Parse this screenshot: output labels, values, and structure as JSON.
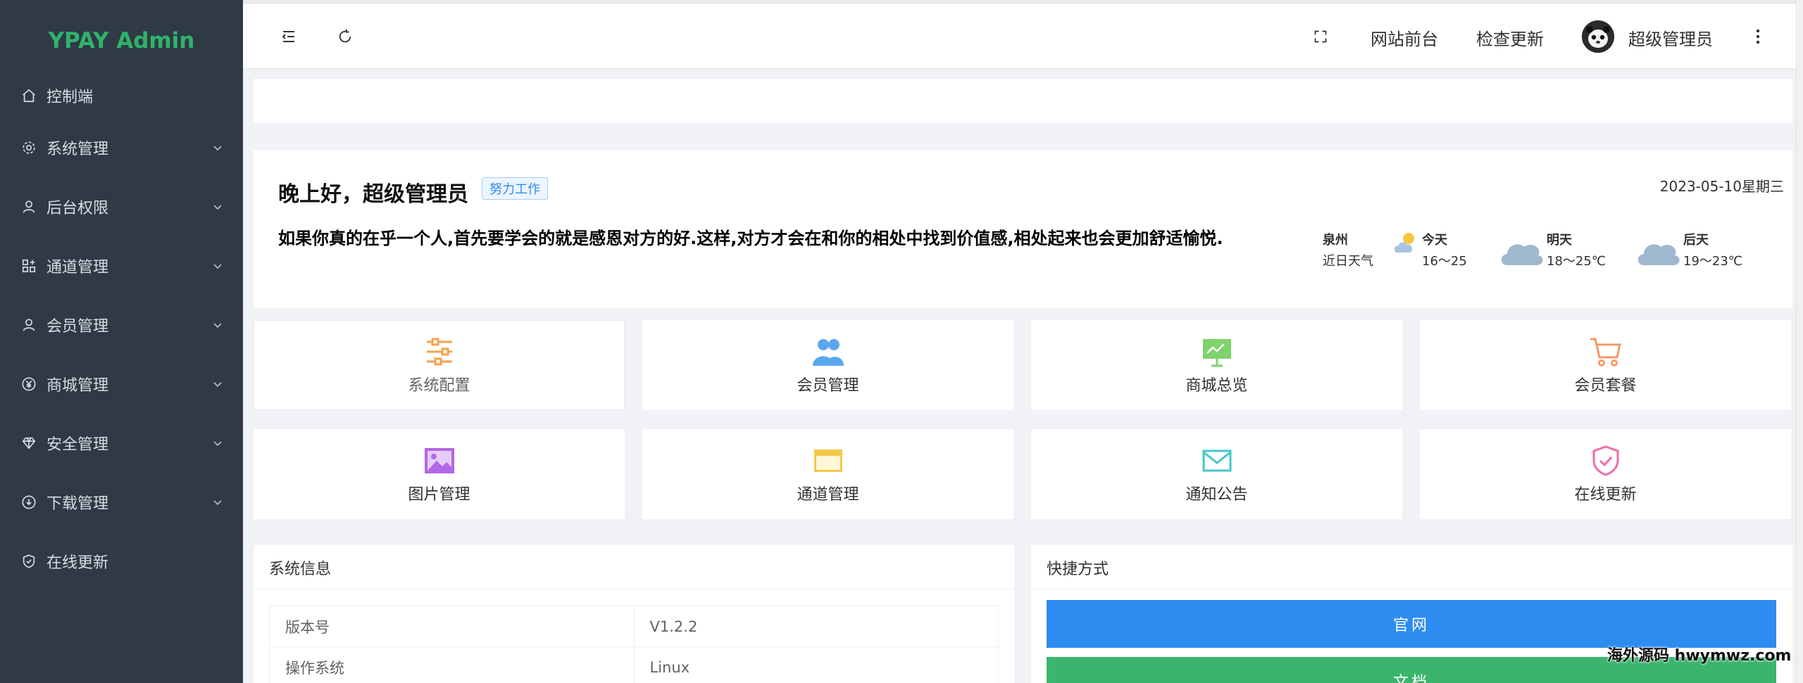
{
  "sidebar": {
    "logo": "YPAY Admin",
    "items": [
      {
        "label": "控制端",
        "icon": "home-icon",
        "expandable": false
      },
      {
        "label": "系统管理",
        "icon": "gear-icon",
        "expandable": true
      },
      {
        "label": "后台权限",
        "icon": "user-icon",
        "expandable": true
      },
      {
        "label": "通道管理",
        "icon": "apps-icon",
        "expandable": true
      },
      {
        "label": "会员管理",
        "icon": "user-icon",
        "expandable": true
      },
      {
        "label": "商城管理",
        "icon": "yen-icon",
        "expandable": true
      },
      {
        "label": "安全管理",
        "icon": "diamond-icon",
        "expandable": true
      },
      {
        "label": "下载管理",
        "icon": "download-icon",
        "expandable": true
      },
      {
        "label": "在线更新",
        "icon": "shield-check-icon",
        "expandable": false
      }
    ]
  },
  "header": {
    "links": [
      "网站前台",
      "检查更新"
    ],
    "username": "超级管理员"
  },
  "welcome": {
    "greeting": "晚上好，超级管理员",
    "tag": "努力工作",
    "date": "2023-05-10星期三",
    "quote": "如果你真的在乎一个人,首先要学会的就是感恩对方的好.这样,对方才会在和你的相处中找到价值感,相处起来也会更加舒适愉悦.",
    "weather": {
      "city": "泉州",
      "subtitle": "近日天气",
      "days": [
        {
          "name": "今天",
          "temp": "16～25"
        },
        {
          "name": "明天",
          "temp": "18～25℃"
        },
        {
          "name": "后天",
          "temp": "19～23℃"
        }
      ]
    }
  },
  "tiles": [
    {
      "label": "系统配置",
      "icon": "sliders-icon",
      "color": "#f7a24b"
    },
    {
      "label": "会员管理",
      "icon": "users-icon",
      "color": "#5aa7ee"
    },
    {
      "label": "商城总览",
      "icon": "presentation-icon",
      "color": "#7ed36a"
    },
    {
      "label": "会员套餐",
      "icon": "cart-icon",
      "color": "#f49a66"
    },
    {
      "label": "图片管理",
      "icon": "image-icon",
      "color": "#b267e6"
    },
    {
      "label": "通道管理",
      "icon": "card-icon",
      "color": "#f4c94a"
    },
    {
      "label": "通知公告",
      "icon": "mail-icon",
      "color": "#45c7c7"
    },
    {
      "label": "在线更新",
      "icon": "shield-check-icon",
      "color": "#f06ba8"
    }
  ],
  "system_info": {
    "title": "系统信息",
    "rows": [
      {
        "key": "版本号",
        "value": "V1.2.2"
      },
      {
        "key": "操作系统",
        "value": "Linux"
      }
    ]
  },
  "shortcuts": {
    "title": "快捷方式",
    "buttons": [
      {
        "label": "官网",
        "color": "#2d8cf0"
      },
      {
        "label": "文档",
        "color": "#3bb56e"
      }
    ]
  },
  "watermark": "海外源码 hwymwz.com"
}
